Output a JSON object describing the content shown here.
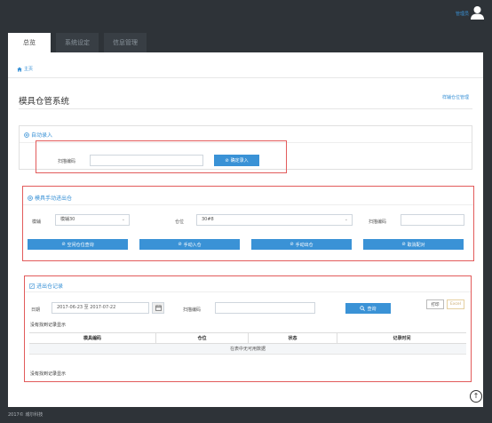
{
  "header": {
    "user_name": "管理员",
    "avatar_icon": "user-avatar-icon"
  },
  "tabs": [
    {
      "label": "总览",
      "active": true
    },
    {
      "label": "系统设定",
      "active": false
    },
    {
      "label": "信息管理",
      "active": false
    }
  ],
  "breadcrumb": {
    "icon": "home-icon",
    "label": "主页"
  },
  "page": {
    "title": "模具仓管系统",
    "top_link": "样辅仓位管理"
  },
  "auto_entry": {
    "title": "自动录入",
    "scan_label": "扫描编码",
    "scan_value": "",
    "confirm_button": "确定录入"
  },
  "manual": {
    "title": "模具手动进出仓",
    "fields": {
      "mold_label": "模辅",
      "mold_value": "模辅30",
      "location_label": "仓位",
      "location_value": "30#8",
      "scan_label": "扫描编码",
      "scan_value": ""
    },
    "buttons": [
      "空闲仓位查询",
      "手动入仓",
      "手动出仓",
      "取消配对"
    ]
  },
  "records": {
    "title": "进出仓记录",
    "date_label": "日期",
    "date_value": "2017-06-23 至 2017-07-22",
    "scan_label": "扫描编码",
    "scan_value": "",
    "search_button": "查询",
    "print_button": "打印",
    "excel_button": "Excel",
    "no_records_top": "没有找到记录显示",
    "columns": [
      "模具编码",
      "仓位",
      "状态",
      "记录时间"
    ],
    "empty_table": "在表中无可用数据",
    "no_records_bottom": "没有找到记录显示"
  },
  "footer": {
    "text": "2017© 城尔科技"
  },
  "colors": {
    "accent": "#3a92d6",
    "highlight_border": "#e25b5b",
    "dark_bg": "#2e3338"
  }
}
